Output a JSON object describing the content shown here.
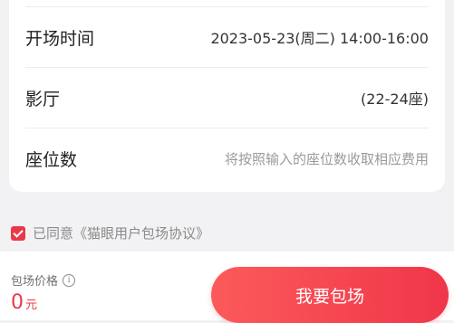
{
  "details": {
    "rows": [
      {
        "label": "开场时间",
        "value": "2023-05-23(周二) 14:00-16:00"
      },
      {
        "label": "影厅",
        "value": "(22-24座)"
      },
      {
        "label": "座位数",
        "value": "将按照输入的座位数收取相应费用"
      }
    ]
  },
  "agreement": {
    "checked": true,
    "text": "已同意《猫眼用户包场协议》"
  },
  "footer": {
    "price_label": "包场价格",
    "info_glyph": "i",
    "price_value": "0",
    "price_unit": "元",
    "book_button_label": "我要包场"
  },
  "colors": {
    "accent": "#e8394a",
    "button_start": "#fb5a5a",
    "button_end": "#f0364a"
  },
  "icons": [
    "check-icon",
    "info-icon"
  ]
}
